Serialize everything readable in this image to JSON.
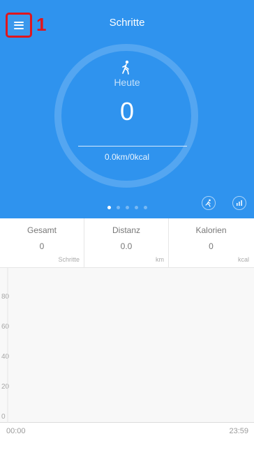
{
  "header": {
    "title": "Schritte",
    "menu_icon": "hamburger-menu-icon",
    "annotation_number": "1",
    "accent": "#2f93ee"
  },
  "ring": {
    "icon": "walking-person-icon",
    "label": "Heute",
    "steps": "0",
    "distance_kcal": "0.0km/0kcal"
  },
  "carousel": {
    "page_count": 5,
    "active_page": 1
  },
  "action_buttons": [
    {
      "icon": "running-icon"
    },
    {
      "icon": "bar-chart-icon"
    }
  ],
  "summary": [
    {
      "label": "Gesamt",
      "value": "0",
      "unit": "Schritte"
    },
    {
      "label": "Distanz",
      "value": "0.0",
      "unit": "km"
    },
    {
      "label": "Kalorien",
      "value": "0",
      "unit": "kcal"
    }
  ],
  "chart_data": {
    "type": "bar",
    "x": [
      "00:00",
      "23:59"
    ],
    "y_ticks": [
      "80",
      "60",
      "40",
      "20",
      "0"
    ],
    "ylim": [
      0,
      80
    ],
    "values": [],
    "title": "",
    "xlabel": "",
    "ylabel": ""
  }
}
